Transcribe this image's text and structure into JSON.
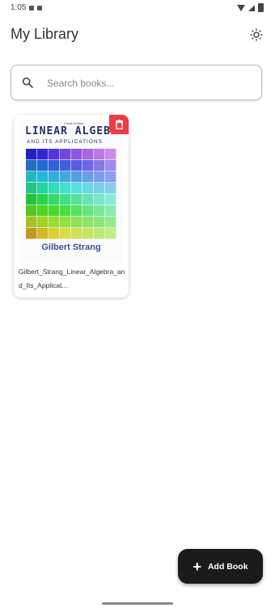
{
  "status_bar": {
    "time": "1:05"
  },
  "app_bar": {
    "title": "My Library",
    "settings_icon": "gear-icon"
  },
  "search": {
    "placeholder": "Search books...",
    "value": "",
    "icon": "search-icon"
  },
  "books": [
    {
      "file_title": "Gilbert_Strang_Linear_Algebra_and_Its_Applications.pdf",
      "display_title": "Gilbert_Strang_Linear_Algebra_and_Its_Applicat...",
      "cover": {
        "edition": "Fourth Edition",
        "title_line1": "LINEAR ALGEBRA",
        "title_line2": "AND ITS APPLICATIONS",
        "author": "Gilbert Strang"
      },
      "delete_icon": "trash-icon"
    }
  ],
  "fab": {
    "label": "Add Book",
    "icon": "plus-icon"
  },
  "colors": {
    "delete": "#ef3b45",
    "fab": "#1b1b1b",
    "cover_title": "#24306e"
  }
}
